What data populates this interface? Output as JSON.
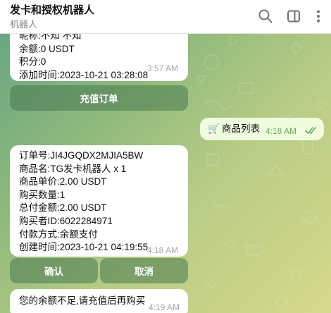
{
  "header": {
    "title": "发卡和授权机器人",
    "subtitle": "机器人",
    "icons": [
      "search-icon",
      "sidebar-toggle-icon",
      "more-icon"
    ]
  },
  "messages": {
    "profile": {
      "lines": [
        "昵称:不知 不知",
        "余额:0 USDT",
        "积分:0",
        "添加时间:2023-10-21 03:28:08"
      ],
      "time": "3:57 AM",
      "button": "充值订单"
    },
    "outgoing": {
      "emoji": "🛒",
      "text": "商品列表",
      "time": "4:18 AM"
    },
    "order": {
      "lines": [
        "订单号:JI4JGQDX2MJIA5BW",
        "商品名:TG发卡机器人 x 1",
        "商品单价:2.00 USDT",
        "购买数量:1",
        "总付金额:2.00 USDT",
        "购买者ID:6022284971",
        "付款方式:余额支付",
        "创建时间:2023-10-21 04:19:55"
      ],
      "time": "4:18 AM",
      "confirm_button": "确认",
      "cancel_button": "取消"
    },
    "notice": {
      "text": "您的余额不足,请充值后再购买",
      "time": "4:19 AM"
    }
  },
  "colors": {
    "incoming_bubble": "#ffffff",
    "outgoing_bubble": "#effdde",
    "read_check": "#5fae5a",
    "keyboard_button": "#6e9a73"
  }
}
